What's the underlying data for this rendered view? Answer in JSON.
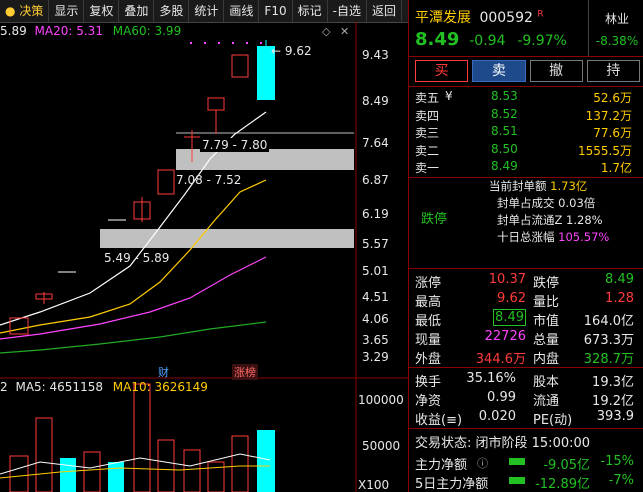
{
  "toolbar": {
    "items": [
      "决策",
      "显示",
      "复权",
      "叠加",
      "多股",
      "统计",
      "画线",
      "F10",
      "标记",
      "-自选",
      "返回"
    ]
  },
  "ma": {
    "ma5_prefix": "5.89",
    "ma20": "MA20: 5.31",
    "ma60": "MA60: 3.99"
  },
  "price_axis": [
    "9.43",
    "8.49",
    "7.64",
    "6.87",
    "6.19",
    "5.57",
    "5.01",
    "4.51",
    "4.06",
    "3.65",
    "3.29"
  ],
  "high_marker": "9.62",
  "gaps": [
    "7.79 - 7.80",
    "7.08 - 7.52",
    "5.49 - 5.89"
  ],
  "event_tags": {
    "cai": "财",
    "longhu": "涨榜"
  },
  "vol": {
    "prefix": "2",
    "ma5": "MA5: 4651158",
    "ma10": "MA10: 3626149",
    "axis": [
      "100000",
      "50000",
      "X100"
    ]
  },
  "stock": {
    "name": "平潭发展",
    "code": "000592",
    "flag": "R",
    "price": "8.49",
    "change": "-0.94",
    "pct": "-9.97%",
    "sector": "林业",
    "sector_pct": "-8.38%"
  },
  "actions": [
    "买",
    "卖",
    "撤",
    "持"
  ],
  "asks": [
    {
      "label": "卖五",
      "yen": "¥",
      "price": "8.53",
      "vol": "52.6万"
    },
    {
      "label": "卖四",
      "price": "8.52",
      "vol": "137.2万"
    },
    {
      "label": "卖三",
      "price": "8.51",
      "vol": "77.6万"
    },
    {
      "label": "卖二",
      "price": "8.50",
      "vol": "1555.5万"
    },
    {
      "label": "卖一",
      "price": "8.49",
      "vol": "1.7亿"
    }
  ],
  "limit": {
    "status": "跌停",
    "rows": [
      {
        "label": "当前封单额",
        "value": "1.73亿"
      },
      {
        "label": "封单占成交",
        "value": "0.03倍"
      },
      {
        "label": "封单占流通Z",
        "value": "1.28%"
      },
      {
        "label": "十日总涨幅",
        "value": "105.57%"
      }
    ]
  },
  "quote": [
    [
      {
        "l": "涨停",
        "v": "10.37",
        "c": "red"
      },
      {
        "l": "跌停",
        "v": "8.49",
        "c": "green"
      }
    ],
    [
      {
        "l": "最高",
        "v": "9.62",
        "c": "red"
      },
      {
        "l": "量比",
        "v": "1.28",
        "c": "red"
      }
    ],
    [
      {
        "l": "最低",
        "v": "8.49",
        "c": "green"
      },
      {
        "l": "市值",
        "v": "164.0亿",
        "c": "white"
      }
    ],
    [
      {
        "l": "现量",
        "v": "22726",
        "c": "magenta"
      },
      {
        "l": "总量",
        "v": "673.3万",
        "c": "white"
      }
    ],
    [
      {
        "l": "外盘",
        "v": "344.6万",
        "c": "red"
      },
      {
        "l": "内盘",
        "v": "328.7万",
        "c": "green"
      }
    ]
  ],
  "fund": [
    [
      {
        "l": "换手",
        "v": "35.16%"
      },
      {
        "l": "股本",
        "v": "19.3亿"
      }
    ],
    [
      {
        "l": "净资",
        "v": "0.99"
      },
      {
        "l": "流通",
        "v": "19.2亿"
      }
    ],
    [
      {
        "l": "收益(≡)",
        "v": "0.020"
      },
      {
        "l": "PE(动)",
        "v": "393.9"
      }
    ]
  ],
  "trade_status": "交易状态: 闭市阶段 15:00:00",
  "flows": [
    {
      "label": "主力净额",
      "value": "-9.05亿",
      "pct": "-15%"
    },
    {
      "label": "5日主力净额",
      "value": "-12.89亿",
      "pct": "-7%"
    }
  ],
  "colors": {
    "up": "#ff3b3b",
    "down": "#22c022",
    "ma5": "#ffffff",
    "ma10": "#ffcc00",
    "ma20": "#ff44ff",
    "ma60": "#22aa22",
    "limit": "#00ffff"
  }
}
